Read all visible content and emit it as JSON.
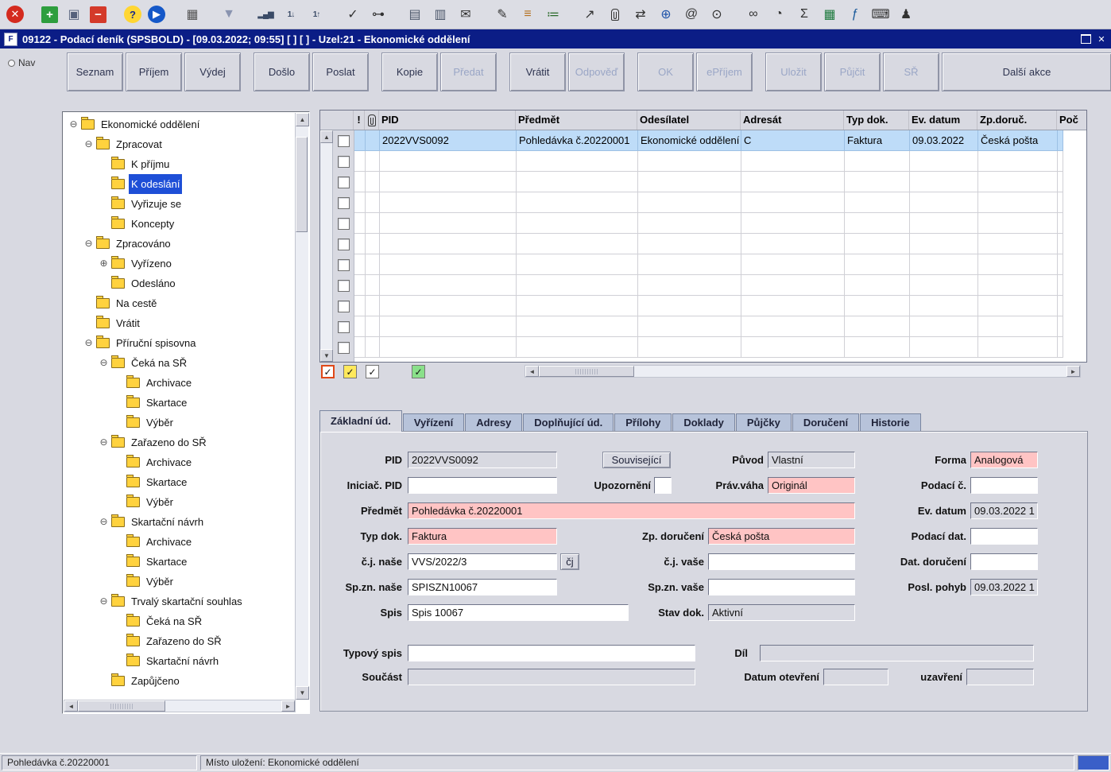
{
  "window": {
    "title": "09122 - Podací deník (SPSBOLD) - [09.03.2022; 09:55]  [ ]  [ ] - Uzel:21 - Ekonomické oddělení",
    "app_icon_letter": "F"
  },
  "nav": {
    "label": "Nav"
  },
  "toolbar": {
    "icons": [
      {
        "name": "close-icon",
        "glyph": "✕",
        "shape": "circle",
        "bg": "#d42a1e",
        "fg": "#ffffff"
      },
      {
        "name": "add-icon",
        "glyph": "+",
        "shape": "square",
        "bg": "#2e9e3e",
        "fg": "#ffffff",
        "gap": true
      },
      {
        "name": "save-icon",
        "glyph": "▣",
        "shape": "plain",
        "fg": "#56617c"
      },
      {
        "name": "remove-icon",
        "glyph": "−",
        "shape": "square",
        "bg": "#d43a2a",
        "fg": "#ffffff"
      },
      {
        "name": "help-icon",
        "glyph": "?",
        "shape": "circle",
        "bg": "#ffd633",
        "fg": "#1a2a8a",
        "gap": true
      },
      {
        "name": "run-icon",
        "glyph": "▶",
        "shape": "circle",
        "bg": "#1558c8",
        "fg": "#ffffff"
      },
      {
        "name": "calendar-icon",
        "glyph": "▦",
        "shape": "plain",
        "fg": "#555555",
        "gap": true
      },
      {
        "name": "filter-icon",
        "glyph": "▼",
        "shape": "plain",
        "fg": "#8a94b0",
        "gap": true
      },
      {
        "name": "chart-icon",
        "glyph": "▂▄▆",
        "shape": "plain",
        "fg": "#3a4a66",
        "gap": true,
        "small": true
      },
      {
        "name": "sort-asc-icon",
        "glyph": "1↓",
        "shape": "plain",
        "fg": "#3a4a66",
        "small": true
      },
      {
        "name": "sort-desc-icon",
        "glyph": "1↑",
        "shape": "plain",
        "fg": "#3a4a66",
        "small": true
      },
      {
        "name": "validate-icon",
        "glyph": "✓",
        "shape": "plain",
        "fg": "#333333",
        "gap": true
      },
      {
        "name": "key-icon",
        "glyph": "⊶",
        "shape": "plain",
        "fg": "#333333"
      },
      {
        "name": "print-icon",
        "glyph": "▤",
        "shape": "plain",
        "fg": "#4a5568",
        "gap": true
      },
      {
        "name": "print-preview-icon",
        "glyph": "▥",
        "shape": "plain",
        "fg": "#4a5568"
      },
      {
        "name": "mail-icon",
        "glyph": "✉",
        "shape": "plain",
        "fg": "#333333"
      },
      {
        "name": "edit-icon",
        "glyph": "✎",
        "shape": "plain",
        "fg": "#333333",
        "gap": true
      },
      {
        "name": "bullet-list-icon",
        "glyph": "≡",
        "shape": "plain",
        "fg": "#b4701e"
      },
      {
        "name": "checklist-icon",
        "glyph": "≔",
        "shape": "plain",
        "fg": "#2a6a2a"
      },
      {
        "name": "open-external-icon",
        "glyph": "↗",
        "shape": "plain",
        "fg": "#333333",
        "gap": true
      },
      {
        "name": "attachment-icon",
        "glyph": "@clip",
        "shape": "plain",
        "fg": "#333333"
      },
      {
        "name": "route-icon",
        "glyph": "⇄",
        "shape": "plain",
        "fg": "#333333"
      },
      {
        "name": "globe-icon",
        "glyph": "⊕",
        "shape": "plain",
        "fg": "#2255aa"
      },
      {
        "name": "at-icon",
        "glyph": "@",
        "shape": "plain",
        "fg": "#333333"
      },
      {
        "name": "eye-icon",
        "glyph": "⊙",
        "shape": "plain",
        "fg": "#333333"
      },
      {
        "name": "binoculars-icon",
        "glyph": "∞",
        "shape": "plain",
        "fg": "#333333",
        "gap": true
      },
      {
        "name": "clock-icon",
        "glyph": "◔",
        "shape": "plain",
        "fg": "#333333"
      },
      {
        "name": "sum-icon",
        "glyph": "Σ",
        "shape": "plain",
        "fg": "#333333"
      },
      {
        "name": "spreadsheet-icon",
        "glyph": "▦",
        "shape": "plain",
        "fg": "#1e7a3e"
      },
      {
        "name": "formula-icon",
        "glyph": "ƒ",
        "shape": "plain",
        "fg": "#1a5a9a"
      },
      {
        "name": "keyboard-icon",
        "glyph": "⌨",
        "shape": "plain",
        "fg": "#333333"
      },
      {
        "name": "user-icon",
        "glyph": "♟",
        "shape": "plain",
        "fg": "#333333"
      }
    ]
  },
  "action_buttons": [
    {
      "name": "seznam",
      "label": "Seznam",
      "enabled": true
    },
    {
      "name": "prijem",
      "label": "Příjem",
      "enabled": true
    },
    {
      "name": "vydej",
      "label": "Výdej",
      "enabled": true
    },
    {
      "name": "doslo",
      "label": "Došlo",
      "enabled": true,
      "gap": true
    },
    {
      "name": "poslat",
      "label": "Poslat",
      "enabled": true
    },
    {
      "name": "kopie",
      "label": "Kopie",
      "enabled": true,
      "gap": true
    },
    {
      "name": "predat",
      "label": "Předat",
      "enabled": false
    },
    {
      "name": "vratit",
      "label": "Vrátit",
      "enabled": true,
      "gap": true
    },
    {
      "name": "odpoved",
      "label": "Odpověď",
      "enabled": false
    },
    {
      "name": "ok",
      "label": "OK",
      "enabled": false,
      "gap": true
    },
    {
      "name": "eprijem",
      "label": "ePříjem",
      "enabled": false
    },
    {
      "name": "ulozit",
      "label": "Uložit",
      "enabled": false,
      "gap": true
    },
    {
      "name": "pujcit",
      "label": "Půjčit",
      "enabled": false
    },
    {
      "name": "sr",
      "label": "SŘ",
      "enabled": false
    },
    {
      "name": "dalsi-akce",
      "label": "Další akce",
      "enabled": true,
      "wide": true,
      "push": true
    }
  ],
  "tree": {
    "items": [
      {
        "label": "Ekonomické oddělení",
        "level": 0,
        "expander": "minus"
      },
      {
        "label": "Zpracovat",
        "level": 1,
        "expander": "minus"
      },
      {
        "label": "K příjmu",
        "level": 2
      },
      {
        "label": "K odeslání",
        "level": 2,
        "selected": true
      },
      {
        "label": "Vyřizuje se",
        "level": 2
      },
      {
        "label": "Koncepty",
        "level": 2
      },
      {
        "label": "Zpracováno",
        "level": 1,
        "expander": "minus"
      },
      {
        "label": "Vyřízeno",
        "level": 2,
        "expander": "plus"
      },
      {
        "label": "Odesláno",
        "level": 2
      },
      {
        "label": "Na cestě",
        "level": 1
      },
      {
        "label": "Vrátit",
        "level": 1
      },
      {
        "label": "Příruční spisovna",
        "level": 1,
        "expander": "minus"
      },
      {
        "label": "Čeká na SŘ",
        "level": 2,
        "expander": "minus"
      },
      {
        "label": "Archivace",
        "level": 3
      },
      {
        "label": "Skartace",
        "level": 3
      },
      {
        "label": "Výběr",
        "level": 3
      },
      {
        "label": "Zařazeno do SŘ",
        "level": 2,
        "expander": "minus"
      },
      {
        "label": "Archivace",
        "level": 3
      },
      {
        "label": "Skartace",
        "level": 3
      },
      {
        "label": "Výběr",
        "level": 3
      },
      {
        "label": "Skartační návrh",
        "level": 2,
        "expander": "minus"
      },
      {
        "label": "Archivace",
        "level": 3
      },
      {
        "label": "Skartace",
        "level": 3
      },
      {
        "label": "Výběr",
        "level": 3
      },
      {
        "label": "Trvalý skartační souhlas",
        "level": 2,
        "expander": "minus"
      },
      {
        "label": "Čeká na SŘ",
        "level": 3
      },
      {
        "label": "Zařazeno do SŘ",
        "level": 3
      },
      {
        "label": "Skartační návrh",
        "level": 3
      },
      {
        "label": "Zapůjčeno",
        "level": 2
      }
    ]
  },
  "grid": {
    "columns": [
      {
        "name": "warning",
        "label": "!"
      },
      {
        "name": "attachment",
        "label": "",
        "icon": "paperclip"
      },
      {
        "name": "pid",
        "label": "PID"
      },
      {
        "name": "predmet",
        "label": "Předmět"
      },
      {
        "name": "odesilatel",
        "label": "Odesílatel"
      },
      {
        "name": "adresat",
        "label": "Adresát"
      },
      {
        "name": "typ-dok",
        "label": "Typ dok."
      },
      {
        "name": "ev-datum",
        "label": "Ev. datum"
      },
      {
        "name": "zp-doruc",
        "label": "Zp.doruč."
      },
      {
        "name": "poc",
        "label": "Poč"
      }
    ],
    "row_values": [
      "",
      "",
      "2022VVS0092",
      "Pohledávka č.20220001",
      "Ekonomické oddělení",
      "C",
      "Faktura",
      "09.03.2022",
      "Česká pošta",
      ""
    ],
    "visible_rows": 11
  },
  "filter_checkboxes": [
    {
      "name": "filter-red",
      "style": "red-frame",
      "checked": true,
      "color": "#e04818"
    },
    {
      "name": "filter-yellow",
      "style": "yellow",
      "checked": true,
      "color": "#ffe95c"
    },
    {
      "name": "filter-white",
      "style": "white",
      "checked": true,
      "color": "#ffffff"
    },
    {
      "name": "filter-green",
      "style": "green",
      "checked": true,
      "color": "#8ae08a",
      "gap": true
    }
  ],
  "tabs": [
    {
      "name": "zakladni-udaje",
      "label": "Základní úd.",
      "active": true
    },
    {
      "name": "vyrizeni",
      "label": "Vyřízení"
    },
    {
      "name": "adresy",
      "label": "Adresy"
    },
    {
      "name": "doplnujici-udaje",
      "label": "Doplňující úd."
    },
    {
      "name": "prilohy",
      "label": "Přílohy"
    },
    {
      "name": "doklady",
      "label": "Doklady"
    },
    {
      "name": "pujcky",
      "label": "Půjčky"
    },
    {
      "name": "doruceni",
      "label": "Doručení"
    },
    {
      "name": "historie",
      "label": "Historie"
    }
  ],
  "form": {
    "pid": {
      "label": "PID",
      "value": "2022VVS0092"
    },
    "souvisejici": {
      "label": "Související"
    },
    "puvod": {
      "label": "Původ",
      "value": "Vlastní"
    },
    "forma": {
      "label": "Forma",
      "value": "Analogová"
    },
    "iniciac_pid": {
      "label": "Iniciač. PID",
      "value": ""
    },
    "upozorneni": {
      "label": "Upozornění",
      "value": ""
    },
    "prav_vaha": {
      "label": "Práv.váha",
      "value": "Originál"
    },
    "podaci_c": {
      "label": "Podací č.",
      "value": ""
    },
    "predmet": {
      "label": "Předmět",
      "value": "Pohledávka č.20220001"
    },
    "ev_datum": {
      "label": "Ev. datum",
      "value": "09.03.2022 1"
    },
    "typ_dok": {
      "label": "Typ dok.",
      "value": "Faktura"
    },
    "zp_doruceni": {
      "label": "Zp. doručení",
      "value": "Česká pošta"
    },
    "podaci_dat": {
      "label": "Podací dat.",
      "value": ""
    },
    "cj_nase": {
      "label": "č.j. naše",
      "value": "VVS/2022/3",
      "button": "čj"
    },
    "cj_vase": {
      "label": "č.j. vaše",
      "value": ""
    },
    "dat_doruceni": {
      "label": "Dat. doručení",
      "value": ""
    },
    "sp_zn_nase": {
      "label": "Sp.zn. naše",
      "value": "SPISZN10067"
    },
    "sp_zn_vase": {
      "label": "Sp.zn. vaše",
      "value": ""
    },
    "posl_pohyb": {
      "label": "Posl. pohyb",
      "value": "09.03.2022 1"
    },
    "spis": {
      "label": "Spis",
      "value": "Spis 10067"
    },
    "stav_dok": {
      "label": "Stav dok.",
      "value": "Aktivní"
    },
    "typovy_spis": {
      "label": "Typový spis",
      "value": ""
    },
    "dil": {
      "label": "Díl",
      "value": ""
    },
    "soucast": {
      "label": "Součást",
      "value": ""
    },
    "datum_otevreni": {
      "label": "Datum otevření",
      "value": ""
    },
    "uzavreni": {
      "label": "uzavření",
      "value": ""
    }
  },
  "status": {
    "doc": "Pohledávka č.20220001",
    "location": "Místo uložení: Ekonomické oddělení",
    "indicator_color": "#3a5fc8"
  }
}
